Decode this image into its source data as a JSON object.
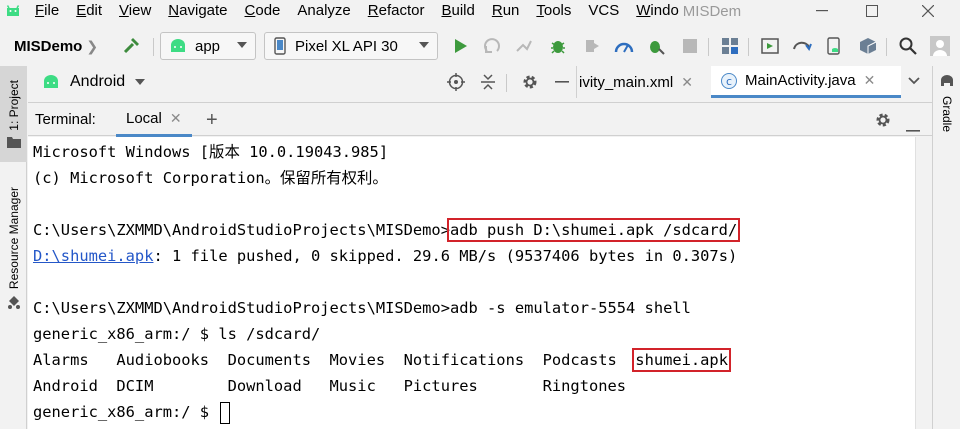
{
  "menubar": {
    "items": [
      "File",
      "Edit",
      "View",
      "Navigate",
      "Code",
      "Analyze",
      "Refactor",
      "Build",
      "Run",
      "Tools",
      "VCS",
      "Windo"
    ],
    "underline_first": [
      true,
      true,
      true,
      true,
      true,
      false,
      true,
      true,
      true,
      true,
      false,
      true
    ],
    "window_title": "MISDem"
  },
  "toolbar": {
    "project_name": "MISDemo",
    "run_config": "app",
    "device": "Pixel XL API 30"
  },
  "sidebar": {
    "project_tab": "1: Project",
    "resource_manager_tab": "Resource Manager",
    "gradle_tab": "Gradle"
  },
  "project_header": {
    "view_mode": "Android"
  },
  "editor_tabs": [
    {
      "label": "ivity_main.xml",
      "active": false
    },
    {
      "label": "MainActivity.java",
      "active": true
    }
  ],
  "terminal": {
    "title": "Terminal:",
    "tab": "Local",
    "lines": {
      "l1": "Microsoft Windows [版本 10.0.19043.985]",
      "l2": "(c) Microsoft Corporation。保留所有权利。",
      "l3_prompt": "C:\\Users\\ZXMMD\\AndroidStudioProjects\\MISDemo>",
      "l3_cmd": "adb push D:\\shumei.apk /sdcard/",
      "l4_link": "D:\\shumei.apk",
      "l4_rest": ": 1 file pushed, 0 skipped. 29.6 MB/s (9537406 bytes in 0.307s)",
      "l5": "C:\\Users\\ZXMMD\\AndroidStudioProjects\\MISDemo>adb -s emulator-5554 shell",
      "l6": "generic_x86_arm:/ $ ls /sdcard/",
      "l7_a": "Alarms   Audiobooks  Documents  Movies  Notifications  Podcasts  ",
      "l7_b": "shumei.apk",
      "l8": "Android  DCIM        Download   Music   Pictures       Ringtones",
      "l9": "generic_x86_arm:/ $ "
    }
  },
  "colors": {
    "accent": "#4a88c7",
    "highlight_box": "#d2232a",
    "link": "#2457c8",
    "android_green": "#3ddc84"
  }
}
